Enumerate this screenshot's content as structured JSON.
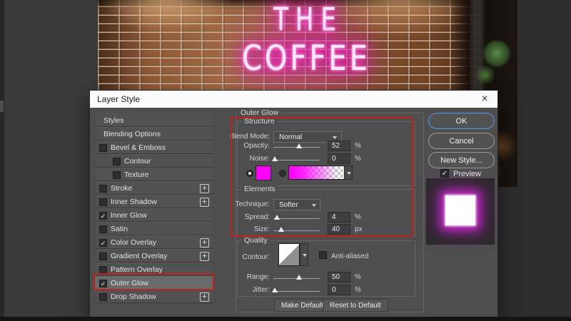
{
  "window": {
    "title": "Layer Style"
  },
  "icons": {
    "close": "×",
    "check": "✓",
    "plus": "+"
  },
  "canvas": {
    "neon_line1": "THE",
    "neon_line2": "COFFEE"
  },
  "sidebar": {
    "items": [
      {
        "label": "Styles",
        "checkbox": false,
        "checked": false,
        "plus": false,
        "indent": false,
        "selected": false
      },
      {
        "label": "Blending Options",
        "checkbox": false,
        "checked": false,
        "plus": false,
        "indent": false,
        "selected": false
      },
      {
        "label": "Bevel & Emboss",
        "checkbox": true,
        "checked": false,
        "plus": false,
        "indent": false,
        "selected": false
      },
      {
        "label": "Contour",
        "checkbox": true,
        "checked": false,
        "plus": false,
        "indent": true,
        "selected": false
      },
      {
        "label": "Texture",
        "checkbox": true,
        "checked": false,
        "plus": false,
        "indent": true,
        "selected": false
      },
      {
        "label": "Stroke",
        "checkbox": true,
        "checked": false,
        "plus": true,
        "indent": false,
        "selected": false
      },
      {
        "label": "Inner Shadow",
        "checkbox": true,
        "checked": false,
        "plus": true,
        "indent": false,
        "selected": false
      },
      {
        "label": "Inner Glow",
        "checkbox": true,
        "checked": true,
        "plus": false,
        "indent": false,
        "selected": false
      },
      {
        "label": "Satin",
        "checkbox": true,
        "checked": false,
        "plus": false,
        "indent": false,
        "selected": false
      },
      {
        "label": "Color Overlay",
        "checkbox": true,
        "checked": true,
        "plus": true,
        "indent": false,
        "selected": false
      },
      {
        "label": "Gradient Overlay",
        "checkbox": true,
        "checked": false,
        "plus": true,
        "indent": false,
        "selected": false
      },
      {
        "label": "Pattern Overlay",
        "checkbox": true,
        "checked": false,
        "plus": false,
        "indent": false,
        "selected": false
      },
      {
        "label": "Outer Glow",
        "checkbox": true,
        "checked": true,
        "plus": false,
        "indent": false,
        "selected": true,
        "highlighted": true
      },
      {
        "label": "Drop Shadow",
        "checkbox": true,
        "checked": false,
        "plus": true,
        "indent": false,
        "selected": false
      }
    ]
  },
  "panel": {
    "title": "Outer Glow",
    "structure": {
      "label": "Structure",
      "blend_mode_label": "Blend Mode:",
      "blend_mode_value": "Normal",
      "opacity_label": "Opacity:",
      "opacity_value": "52",
      "opacity_unit": "%",
      "noise_label": "Noise:",
      "noise_value": "0",
      "noise_unit": "%",
      "glow_color": "#ff00ff",
      "color_selected": "solid"
    },
    "elements": {
      "label": "Elements",
      "technique_label": "Technique:",
      "technique_value": "Softer",
      "spread_label": "Spread:",
      "spread_value": "4",
      "spread_unit": "%",
      "size_label": "Size:",
      "size_value": "40",
      "size_unit": "px"
    },
    "quality": {
      "label": "Quality",
      "contour_label": "Contour:",
      "anti_aliased_label": "Anti-aliased",
      "anti_aliased_checked": false,
      "range_label": "Range:",
      "range_value": "50",
      "range_unit": "%",
      "jitter_label": "Jitter:",
      "jitter_value": "0",
      "jitter_unit": "%"
    },
    "make_default": "Make Default",
    "reset_default": "Reset to Default"
  },
  "actions": {
    "ok": "OK",
    "cancel": "Cancel",
    "new_style": "New Style...",
    "preview_label": "Preview",
    "preview_checked": true
  },
  "colors": {
    "highlight_red": "#c1201d",
    "glow_magenta": "#ff00ff",
    "ok_border_blue": "#5b8fd4",
    "neon_pink": "#ff3fd6"
  }
}
